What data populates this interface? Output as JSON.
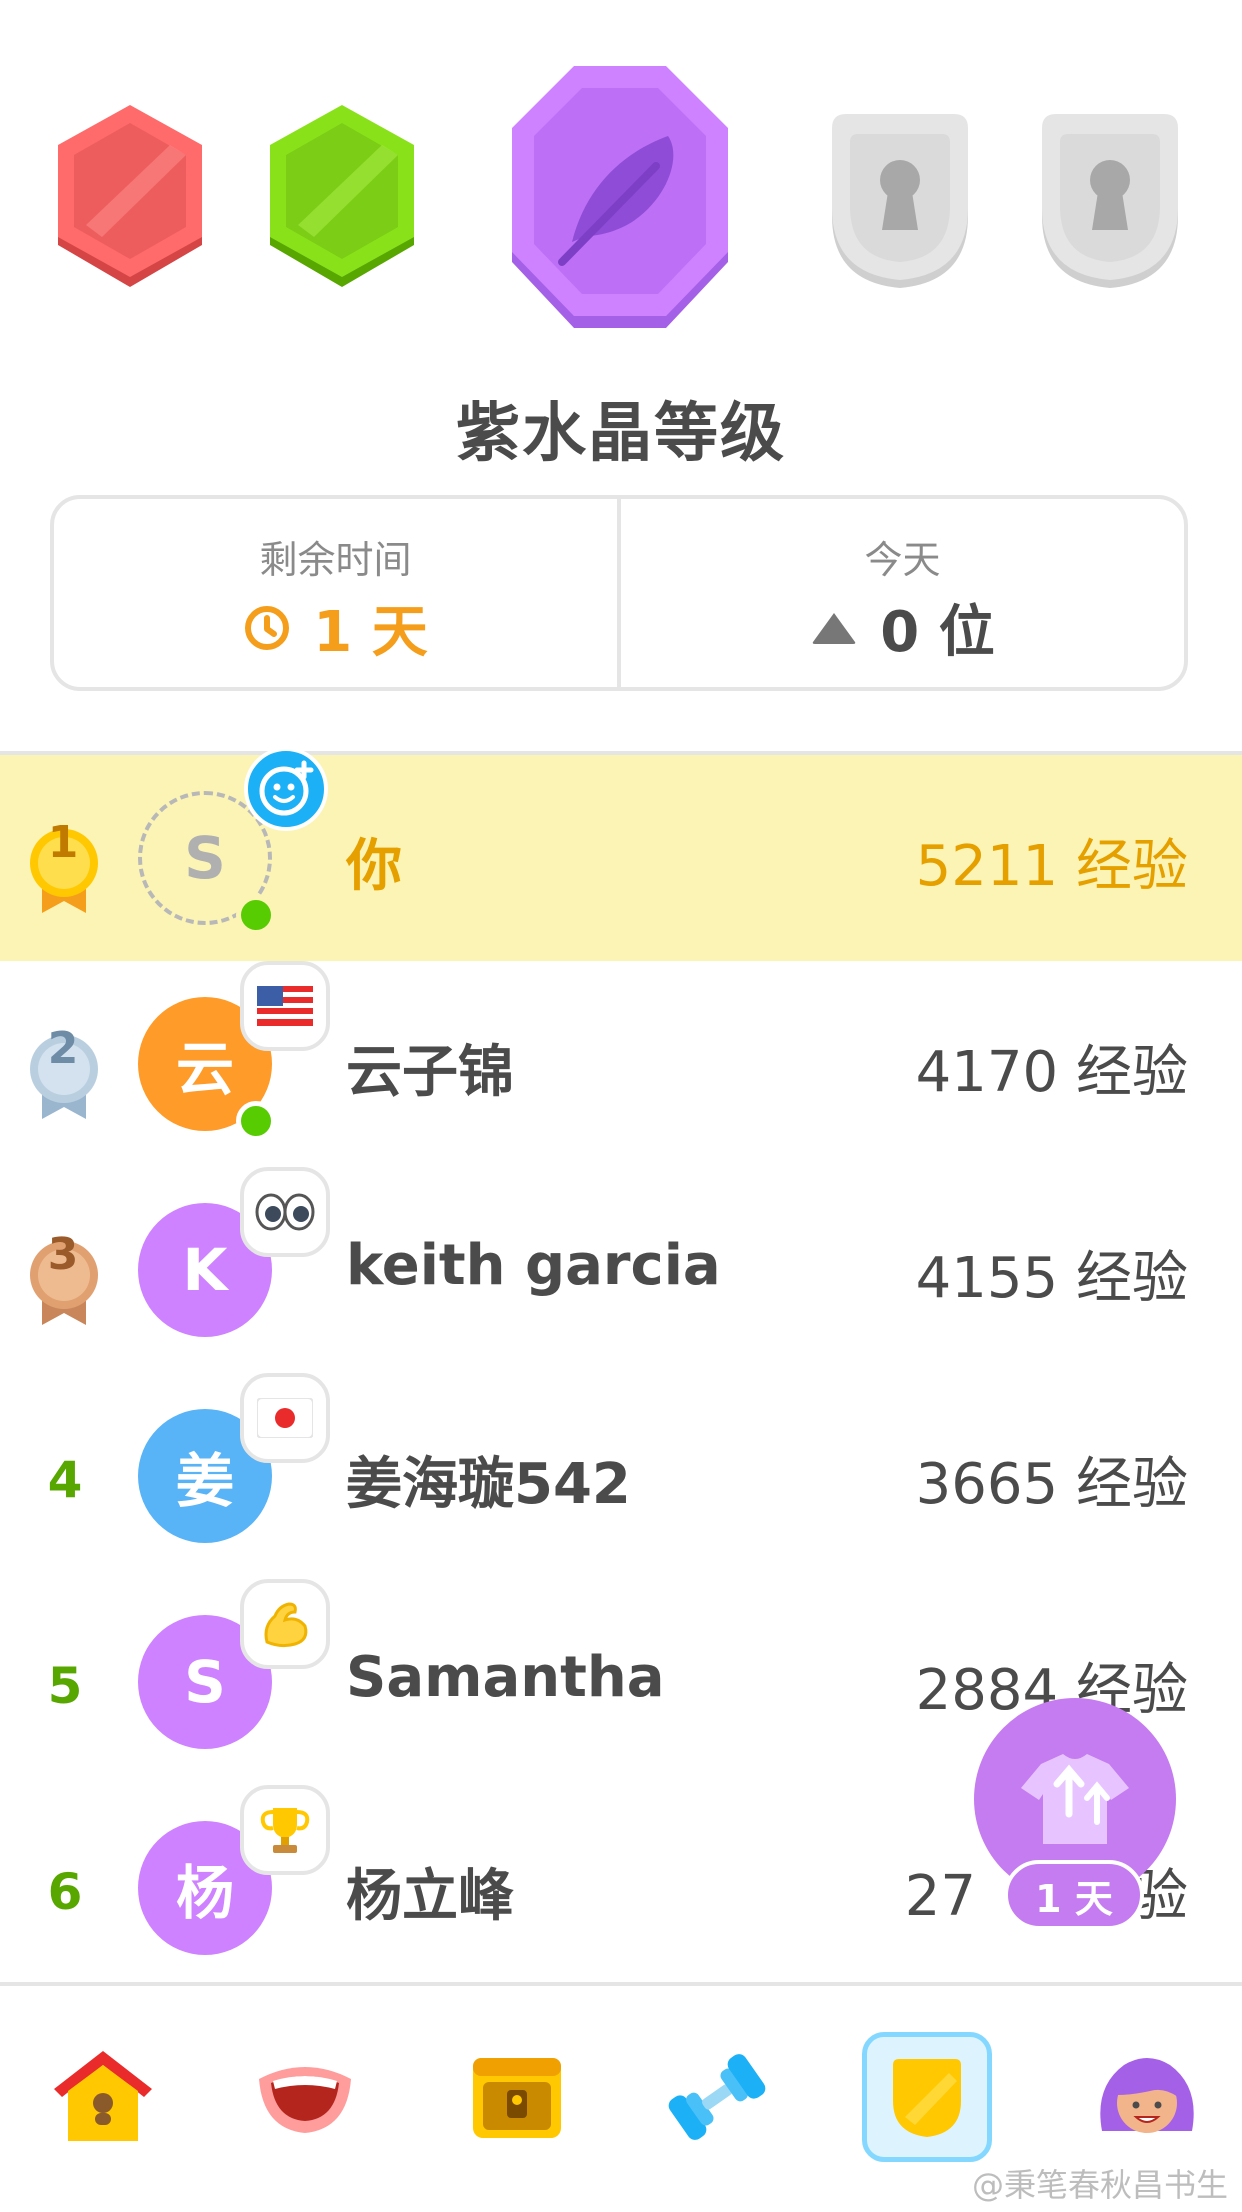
{
  "league": {
    "title": "紫水晶等级",
    "badges": [
      {
        "name": "ruby",
        "color": "#ff6b6b",
        "state": "completed"
      },
      {
        "name": "emerald",
        "color": "#89e219",
        "state": "completed"
      },
      {
        "name": "amethyst",
        "color": "#ce82ff",
        "state": "current"
      },
      {
        "name": "locked",
        "color": "#dcdcdc",
        "state": "locked"
      },
      {
        "name": "locked",
        "color": "#dcdcdc",
        "state": "locked"
      }
    ]
  },
  "stats": {
    "time_label": "剩余时间",
    "time_value": "1 天",
    "today_label": "今天",
    "today_value": "0 位"
  },
  "leaderboard": [
    {
      "rank": "1",
      "medal": "gold",
      "initial": "S",
      "avatar_color": "#ffffff",
      "flair": "add-friend",
      "online": true,
      "name": "你",
      "xp": "5211 经验",
      "is_me": true
    },
    {
      "rank": "2",
      "medal": "silver",
      "initial": "云",
      "avatar_color": "#ff9b29",
      "flair": "us-flag",
      "online": true,
      "name": "云子锦",
      "xp": "4170 经验",
      "is_me": false
    },
    {
      "rank": "3",
      "medal": "bronze",
      "initial": "K",
      "avatar_color": "#ce82ff",
      "flair": "eyes",
      "online": false,
      "name": "keith garcia",
      "xp": "4155 经验",
      "is_me": false
    },
    {
      "rank": "4",
      "medal": "",
      "initial": "姜",
      "avatar_color": "#58b4f7",
      "flair": "japan-flag",
      "online": false,
      "name": "姜海璇542",
      "xp": "3665 经验",
      "is_me": false
    },
    {
      "rank": "5",
      "medal": "",
      "initial": "S",
      "avatar_color": "#ce82ff",
      "flair": "muscle",
      "online": false,
      "name": "Samantha",
      "xp": "2884 经验",
      "is_me": false
    },
    {
      "rank": "6",
      "medal": "",
      "initial": "杨",
      "avatar_color": "#ce82ff",
      "flair": "trophy",
      "online": false,
      "name": "杨立峰",
      "xp": "27",
      "xp_suffix": "验",
      "is_me": false
    }
  ],
  "boost": {
    "label": "1 天"
  },
  "nav": [
    {
      "name": "home",
      "active": false
    },
    {
      "name": "speak",
      "active": false
    },
    {
      "name": "chest",
      "active": false
    },
    {
      "name": "practice",
      "active": false
    },
    {
      "name": "leagues",
      "active": true
    },
    {
      "name": "profile",
      "active": false
    }
  ],
  "watermark": "@秉笔春秋昌书生"
}
